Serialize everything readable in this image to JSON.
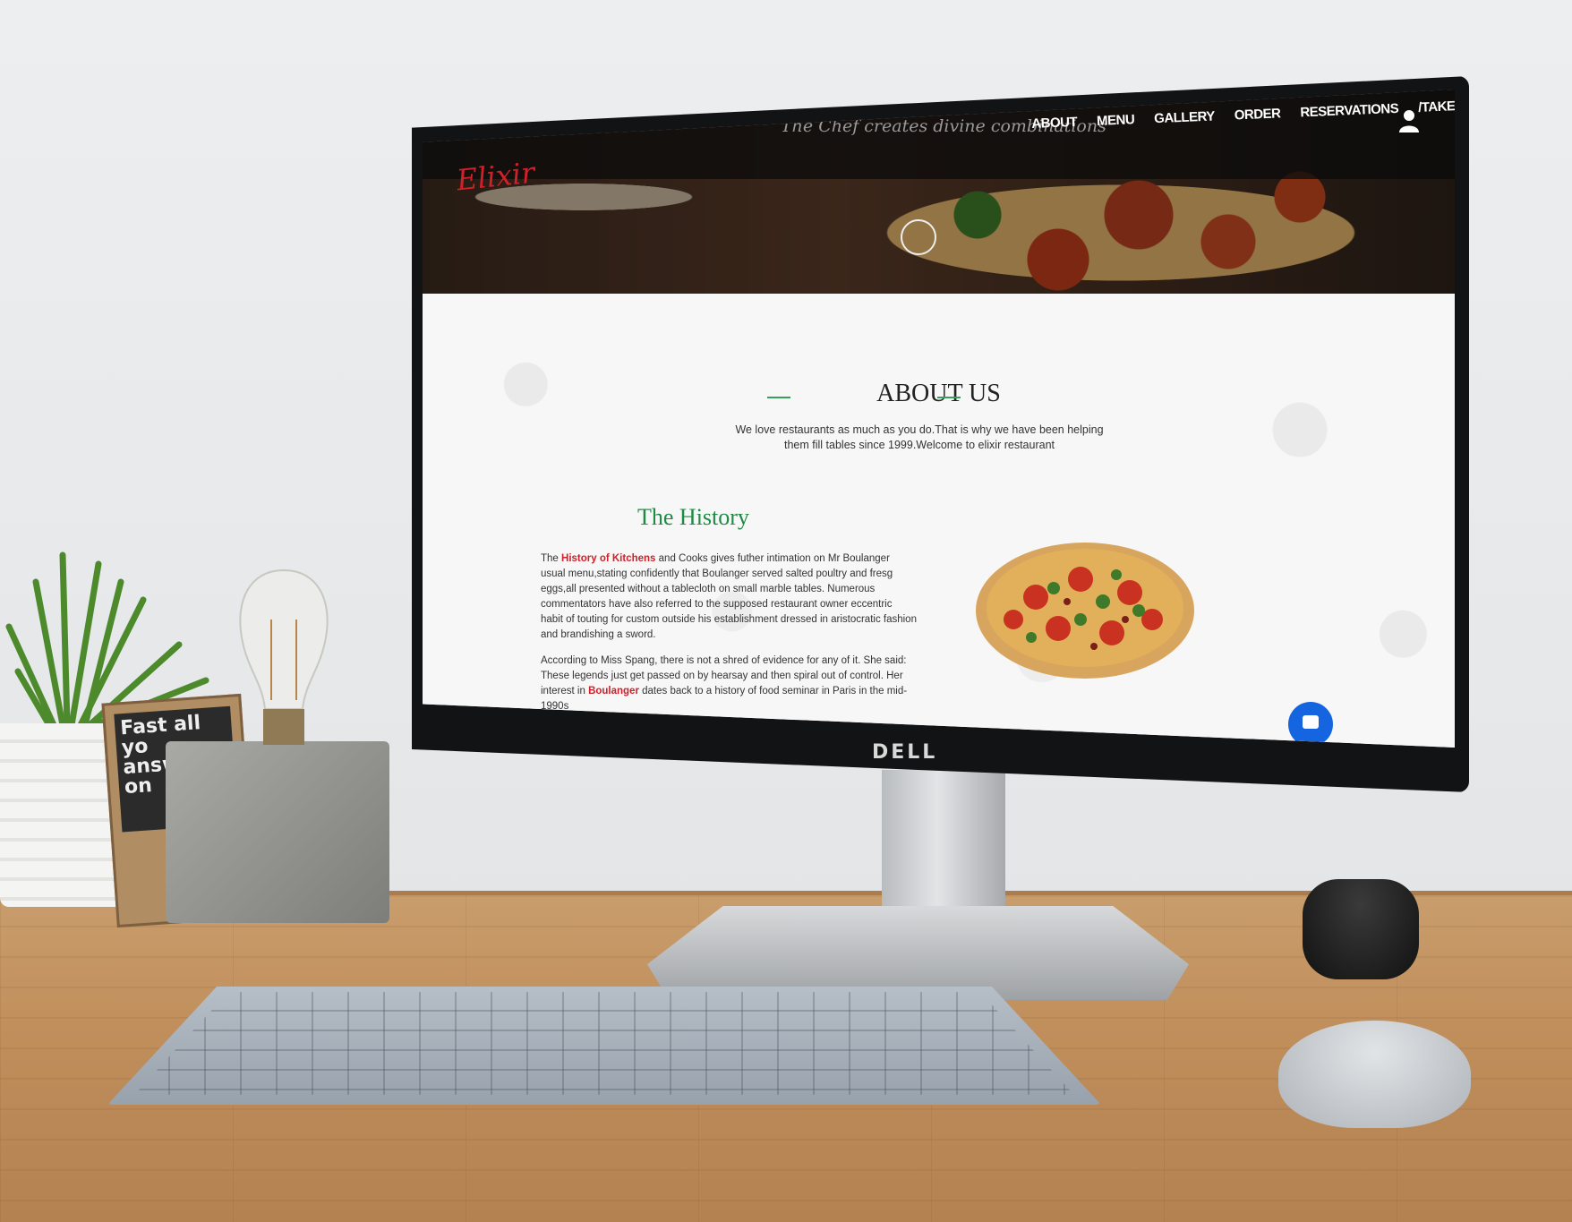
{
  "site": {
    "logo": "Elixir",
    "tagline": "The Chef creates divine combinations",
    "nav": [
      {
        "label": "ABOUT"
      },
      {
        "label": "MENU"
      },
      {
        "label": "GALLERY"
      },
      {
        "label": "ORDER"
      },
      {
        "label": "RESERVATIONS"
      },
      {
        "label": "/TAKEAWAY/"
      }
    ],
    "user_icon": "user-icon"
  },
  "about": {
    "title": "ABOUT US",
    "subtitle": "We love restaurants as much as you do.That is why we have been helping them fill tables since 1999.Welcome to elixir restaurant"
  },
  "history": {
    "title": "The History",
    "p1_pre": "The ",
    "p1_highlight": "History of Kitchens",
    "p1_post": " and Cooks gives futher intimation on Mr Boulanger usual menu,stating confidently that Boulanger served salted poultry and fresg eggs,all presented without a tablecloth on small marble tables. Numerous commentators have also referred to the supposed restaurant owner eccentric habit of touting for custom outside his establishment dressed in aristocratic fashion and brandishing a sword.",
    "p2_pre": "According to Miss Spang, there is not a shred of evidence for any of it. She said: These legends just get passed on by hearsay and then spiral out of control. Her interest in ",
    "p2_highlight": "Boulanger",
    "p2_post": " dates back to a history of food seminar in Paris in the mid-1990s"
  },
  "device": {
    "monitor_brand": "DELL",
    "book_text": "Fast all yo answer on"
  },
  "colors": {
    "accent_red": "#d0202a",
    "accent_green": "#1e8a44",
    "chat_blue": "#1565e0"
  }
}
